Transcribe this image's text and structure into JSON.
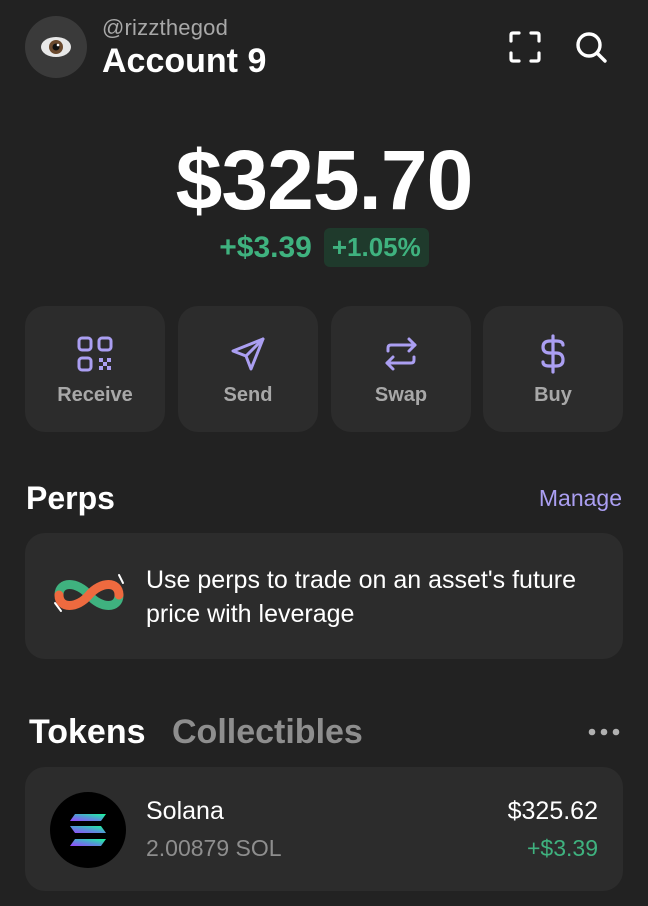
{
  "header": {
    "handle": "@rizzthegod",
    "account_name": "Account 9",
    "avatar_icon": "eye-emoji",
    "scan_icon": "scan-icon",
    "search_icon": "search-icon"
  },
  "balance": {
    "total": "$325.70",
    "change_usd": "+$3.39",
    "change_pct": "+1.05%"
  },
  "actions": [
    {
      "label": "Receive",
      "icon": "qr-code-icon"
    },
    {
      "label": "Send",
      "icon": "send-icon"
    },
    {
      "label": "Swap",
      "icon": "swap-icon"
    },
    {
      "label": "Buy",
      "icon": "dollar-icon"
    }
  ],
  "perps": {
    "title": "Perps",
    "manage_label": "Manage",
    "promo_text": "Use perps to trade on an asset's future price with leverage"
  },
  "tabs": {
    "tokens": "Tokens",
    "collectibles": "Collectibles"
  },
  "tokens": [
    {
      "name": "Solana",
      "amount": "2.00879 SOL",
      "value": "$325.62",
      "change": "+$3.39"
    }
  ],
  "colors": {
    "background": "#222222",
    "card": "#2c2c2c",
    "accent_purple": "#ab9ff2",
    "positive_green": "#3fb27f",
    "muted_text": "#a8a8a8"
  }
}
